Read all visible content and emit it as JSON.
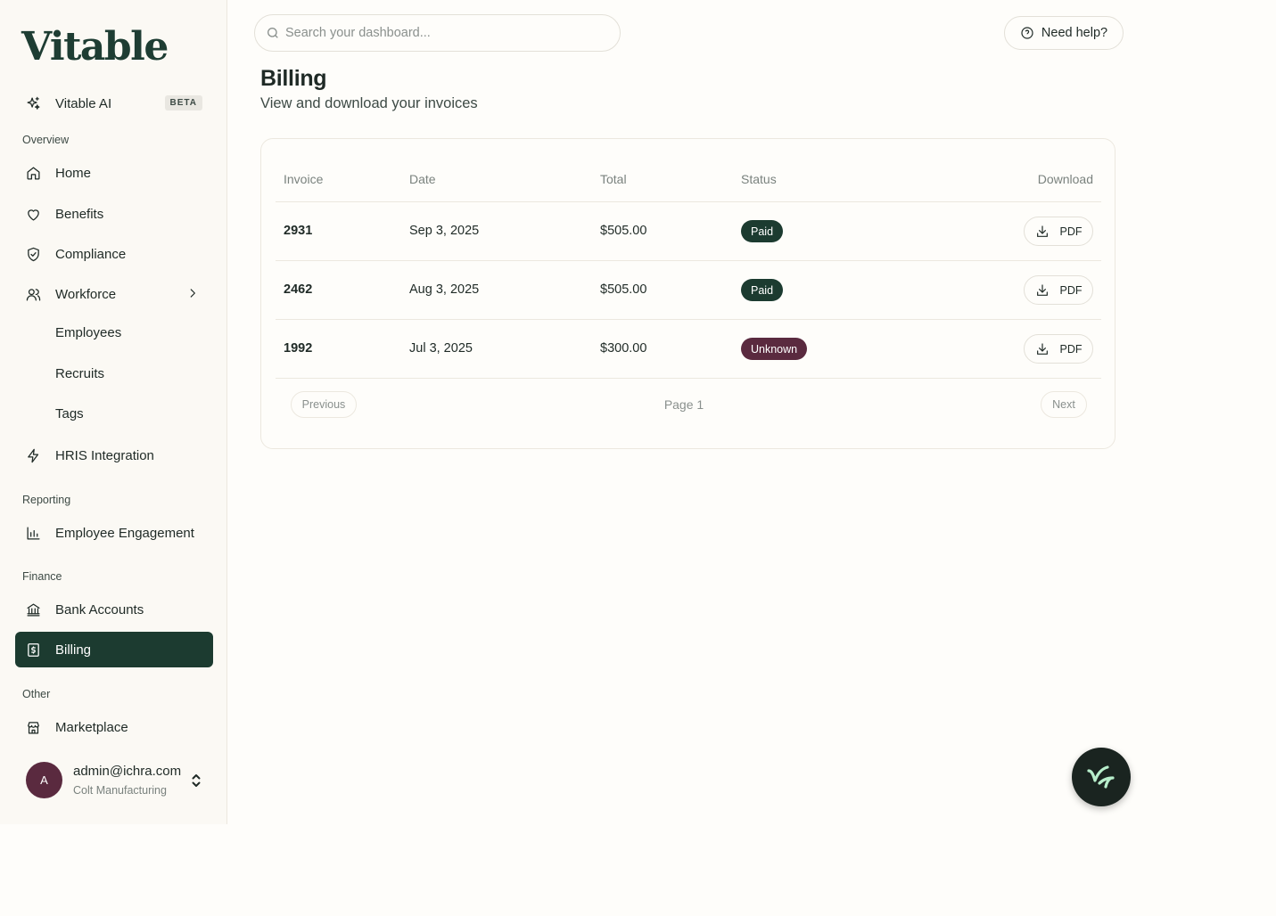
{
  "brand": {
    "logo_text": "Vitable",
    "accent_color": "#1c3b30",
    "alert_color": "#5a2a3f"
  },
  "search": {
    "placeholder": "Search your dashboard..."
  },
  "help": {
    "label": "Need help?"
  },
  "sidebar": {
    "ai": {
      "label": "Vitable AI",
      "badge": "BETA",
      "icon": "sparkles-icon"
    },
    "sections": {
      "overview": "Overview",
      "reporting": "Reporting",
      "finance": "Finance",
      "other": "Other"
    },
    "items": {
      "home": {
        "label": "Home",
        "icon": "home-icon"
      },
      "benefits": {
        "label": "Benefits",
        "icon": "heart-icon"
      },
      "compliance": {
        "label": "Compliance",
        "icon": "shield-check-icon"
      },
      "workforce": {
        "label": "Workforce",
        "icon": "users-icon"
      },
      "employees": {
        "label": "Employees"
      },
      "recruits": {
        "label": "Recruits"
      },
      "tags": {
        "label": "Tags"
      },
      "hris": {
        "label": "HRIS Integration",
        "icon": "zap-icon"
      },
      "engagement": {
        "label": "Employee Engagement",
        "icon": "bar-chart-icon"
      },
      "bank_accounts": {
        "label": "Bank Accounts",
        "icon": "bank-icon"
      },
      "billing": {
        "label": "Billing",
        "icon": "receipt-dollar-icon",
        "active": true
      },
      "marketplace": {
        "label": "Marketplace",
        "icon": "store-icon"
      }
    },
    "user": {
      "avatar_initial": "A",
      "email": "admin@ichra.com",
      "company": "Colt Manufacturing"
    }
  },
  "page": {
    "title": "Billing",
    "subtitle": "View and download your invoices"
  },
  "table": {
    "headers": {
      "invoice": "Invoice",
      "date": "Date",
      "total": "Total",
      "status": "Status",
      "download": "Download"
    },
    "rows": [
      {
        "invoice": "2931",
        "date": "Sep 3, 2025",
        "total": "$505.00",
        "status": "Paid",
        "download": "PDF"
      },
      {
        "invoice": "2462",
        "date": "Aug 3, 2025",
        "total": "$505.00",
        "status": "Paid",
        "download": "PDF"
      },
      {
        "invoice": "1992",
        "date": "Jul 3, 2025",
        "total": "$300.00",
        "status": "Unknown",
        "download": "PDF"
      }
    ]
  },
  "pagination": {
    "previous": "Previous",
    "page": "Page 1",
    "next": "Next"
  }
}
